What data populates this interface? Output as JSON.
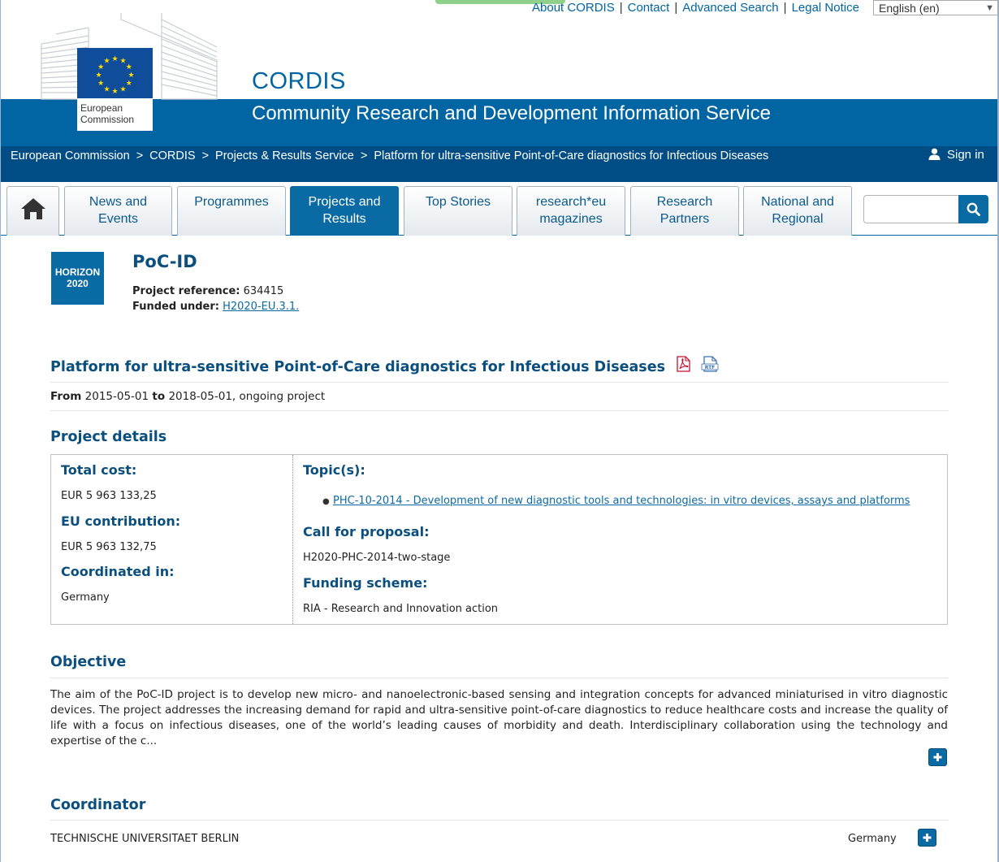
{
  "header": {
    "top_links": [
      "About CORDIS",
      "Contact",
      "Advanced Search",
      "Legal Notice"
    ],
    "language": "English (en)",
    "logo_text": "European Commission",
    "site_name": "CORDIS",
    "site_subtitle": "Community Research and Development Information Service"
  },
  "breadcrumb": {
    "items": [
      "European Commission",
      "CORDIS",
      "Projects & Results Service",
      "Platform for ultra-sensitive Point-of-Care diagnostics for Infectious Diseases"
    ],
    "separator": ">",
    "sign_in": "Sign in"
  },
  "nav": {
    "tabs": [
      {
        "label_1": "News and",
        "label_2": "Events"
      },
      {
        "label_1": "Programmes",
        "label_2": ""
      },
      {
        "label_1": "Projects and",
        "label_2": "Results"
      },
      {
        "label_1": "Top Stories",
        "label_2": ""
      },
      {
        "label_1": "research*eu",
        "label_2": "magazines"
      },
      {
        "label_1": "Research",
        "label_2": "Partners"
      },
      {
        "label_1": "National and",
        "label_2": "Regional"
      }
    ],
    "active_tab": "Projects and Results",
    "search_value": ""
  },
  "project": {
    "programme_badge_1": "HORIZON",
    "programme_badge_2": "2020",
    "acronym": "PoC-ID",
    "reference_label": "Project reference",
    "reference": "634415",
    "funded_label": "Funded under",
    "funded_under": "H2020-EU.3.1.",
    "title": "Platform for ultra-sensitive Point-of-Care diagnostics for Infectious Diseases",
    "from_label": "From",
    "start": "2015-05-01",
    "to_label": "to",
    "end": "2018-05-01",
    "status": ", ongoing project"
  },
  "details": {
    "heading": "Project details",
    "total_cost_label": "Total cost:",
    "total_cost": "EUR 5 963 133,25",
    "eu_contribution_label": "EU contribution:",
    "eu_contribution": "EUR 5 963 132,75",
    "coordinated_label": "Coordinated in:",
    "coordinated_in": "Germany",
    "topics_label": "Topic(s):",
    "topic": "PHC-10-2014 - Development of new diagnostic tools and technologies: in vitro devices, assays and platforms",
    "call_label": "Call for proposal:",
    "call": "H2020-PHC-2014-two-stage",
    "scheme_label": "Funding scheme:",
    "scheme": "RIA - Research and Innovation action"
  },
  "objective": {
    "heading": "Objective",
    "text": "The aim of the PoC-ID project is to develop new micro- and nanoelectronic-based sensing and integration concepts for advanced miniaturised in vitro diagnostic devices. The project addresses the increasing demand for rapid and ultra-sensitive point-of-care diagnostics to reduce healthcare costs and increase the quality of life with a focus on infectious diseases, one of the world’s leading causes of morbidity and death. Interdisciplinary collaboration using the technology and expertise of the c..."
  },
  "coordinator": {
    "heading": "Coordinator",
    "name": "TECHNISCHE UNIVERSITAET BERLIN",
    "country": "Germany"
  },
  "colors": {
    "brand_blue": "#0065a2",
    "dark_blue": "#004d86",
    "heading_blue": "#0b4f7e"
  }
}
